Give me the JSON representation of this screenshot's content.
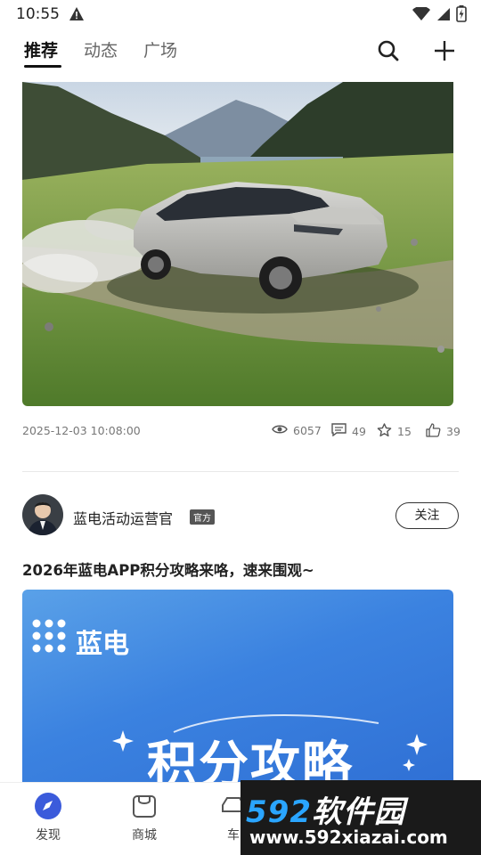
{
  "status_bar": {
    "time": "10:55"
  },
  "top_tabs": [
    {
      "label": "推荐",
      "active": true
    },
    {
      "label": "动态",
      "active": false
    },
    {
      "label": "广场",
      "active": false
    }
  ],
  "post1": {
    "date": "2025-12-03 10:08:00",
    "views": "6057",
    "comments": "49",
    "favorites": "15",
    "likes": "39"
  },
  "post2": {
    "author": "蓝电活动运营官",
    "badge": "官方",
    "follow_label": "关注",
    "title": "2026年蓝电APP积分攻略来咯，速来围观~",
    "image_brand": "蓝电",
    "image_headline": "积分攻略"
  },
  "bottom_nav": [
    {
      "label": "发现",
      "icon": "compass-icon",
      "active": true
    },
    {
      "label": "商城",
      "icon": "shopping-bag-icon",
      "active": false
    },
    {
      "label": "车",
      "icon": "car-icon",
      "active": false
    }
  ],
  "watermark": {
    "brand_a": "592",
    "brand_b": "软件园",
    "url": "www.592xiazai.com"
  },
  "colors": {
    "accent": "#3b5bdb",
    "image_blue": "#3b82e0"
  }
}
